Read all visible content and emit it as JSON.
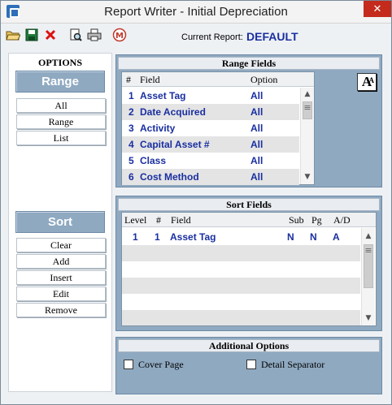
{
  "window": {
    "title": "Report Writer - Initial Depreciation",
    "close_glyph": "✕"
  },
  "toolbar": {
    "buttons": [
      "open-folder-icon",
      "save-icon",
      "delete-icon",
      "print-preview-icon",
      "print-icon",
      "macro-icon"
    ],
    "current_report_label": "Current Report:",
    "current_report_value": "DEFAULT"
  },
  "options": {
    "title": "OPTIONS",
    "range_label": "Range",
    "range_buttons": [
      "All",
      "Range",
      "List"
    ],
    "sort_label": "Sort",
    "sort_buttons": [
      "Clear",
      "Add",
      "Insert",
      "Edit",
      "Remove"
    ]
  },
  "range_fields": {
    "title": "Range  Fields",
    "columns": [
      "#",
      "Field",
      "Option"
    ],
    "rows": [
      {
        "num": "1",
        "field": "Asset Tag",
        "option": "All"
      },
      {
        "num": "2",
        "field": "Date Acquired",
        "option": "All"
      },
      {
        "num": "3",
        "field": "Activity",
        "option": "All"
      },
      {
        "num": "4",
        "field": "Capital Asset #",
        "option": "All"
      },
      {
        "num": "5",
        "field": "Class",
        "option": "All"
      },
      {
        "num": "6",
        "field": "Cost Method",
        "option": "All"
      }
    ],
    "font_button": "A"
  },
  "sort_fields": {
    "title": "Sort Fields",
    "columns": [
      "Level",
      "#",
      "Field",
      "Sub",
      "Pg",
      "A/D"
    ],
    "rows": [
      {
        "level": "1",
        "num": "1",
        "field": "Asset Tag",
        "sub": "N",
        "pg": "N",
        "ad": "A"
      }
    ]
  },
  "additional": {
    "title": "Additional Options",
    "cover_page": "Cover Page",
    "detail_separator": "Detail Separator"
  },
  "colors": {
    "accent_blue": "#1a2fa0",
    "panel_blue": "#8fa9c1",
    "close_red": "#c42b1c"
  }
}
